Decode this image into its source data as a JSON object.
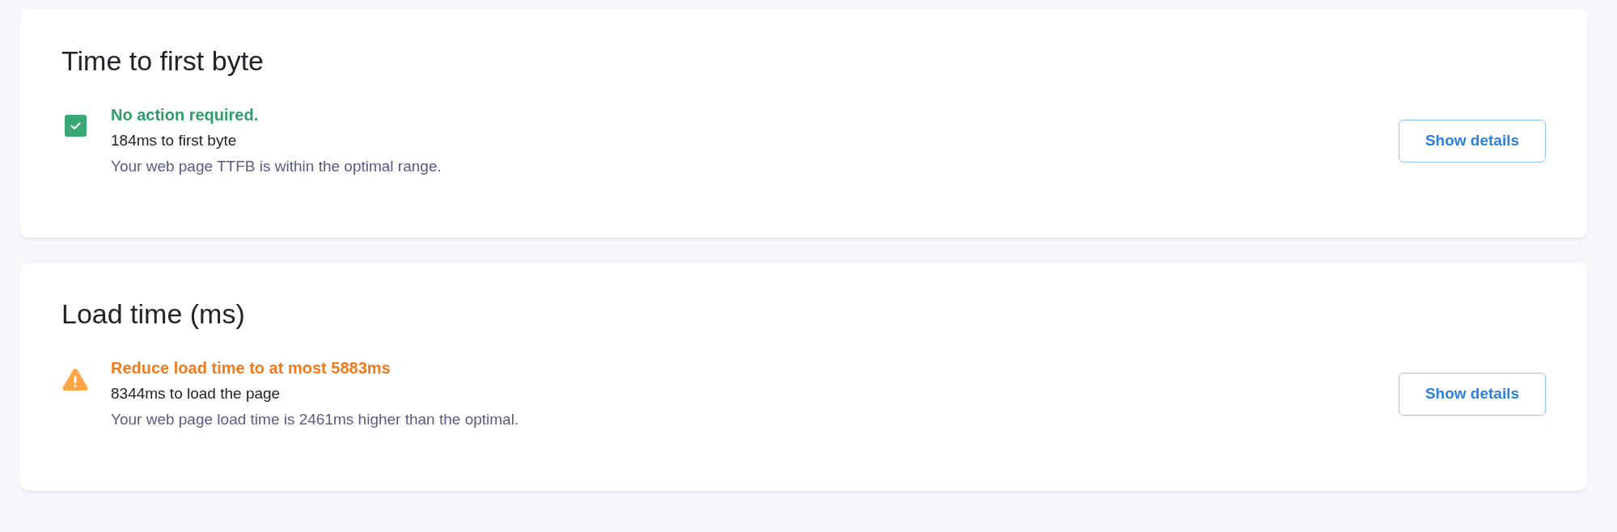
{
  "cards": [
    {
      "title": "Time to first byte",
      "status": {
        "kind": "ok",
        "headline": "No action required.",
        "metric": "184ms to first byte",
        "detail": "Your web page TTFB is within the optimal range."
      },
      "button": "Show details"
    },
    {
      "title": "Load time (ms)",
      "status": {
        "kind": "warning",
        "headline": "Reduce load time to at most 5883ms",
        "metric": "8344ms to load the page",
        "detail": "Your web page load time is 2461ms higher than the optimal."
      },
      "button": "Show details"
    }
  ]
}
